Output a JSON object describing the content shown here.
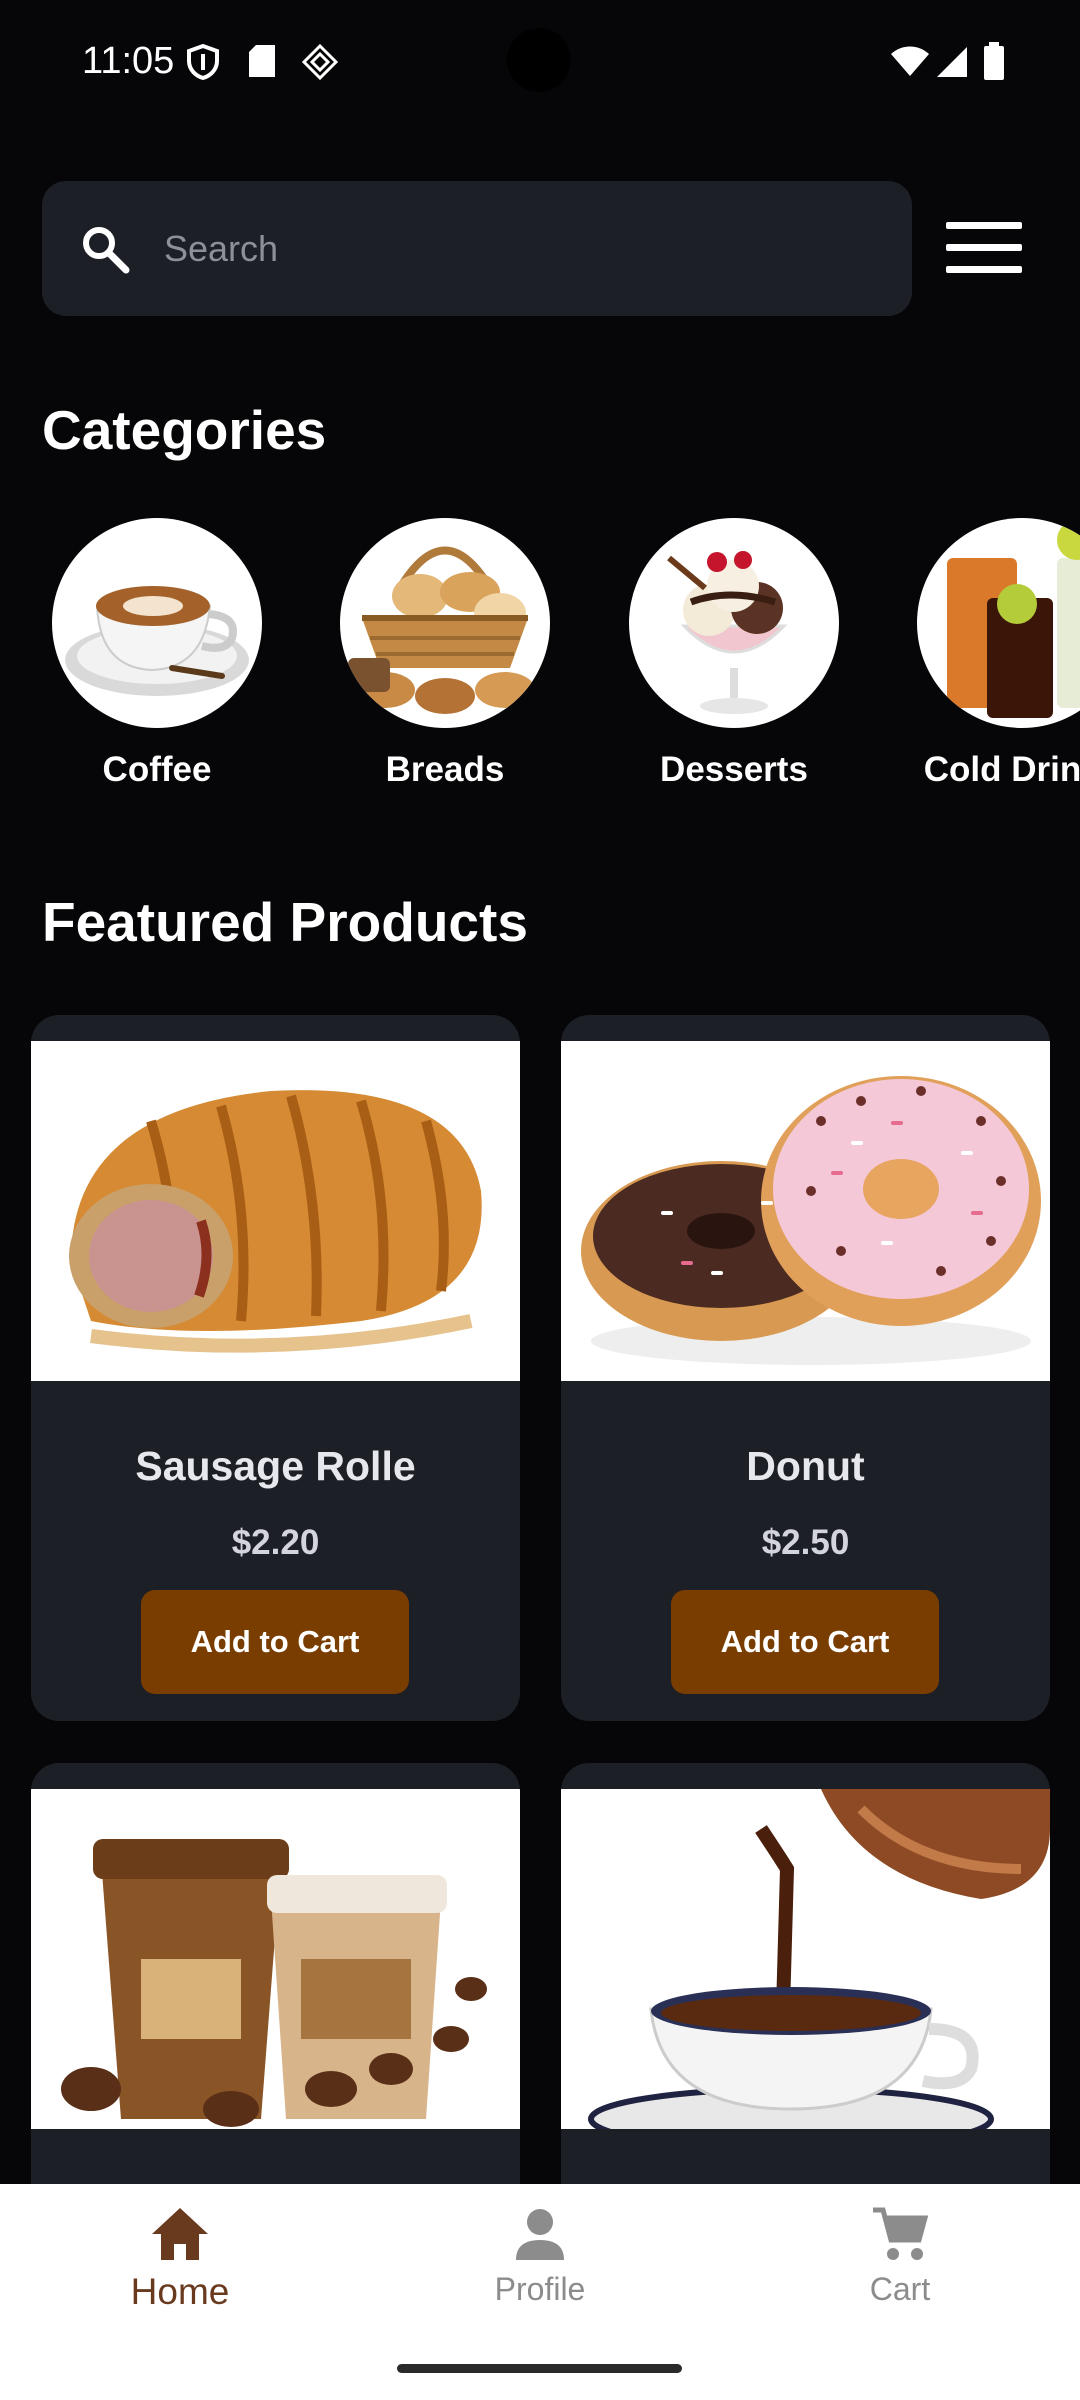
{
  "status_bar": {
    "time": "11:05"
  },
  "search": {
    "placeholder": "Search"
  },
  "sections": {
    "categories_title": "Categories",
    "featured_title": "Featured Products"
  },
  "categories": [
    {
      "name": "Coffee",
      "icon": "coffee-cup-icon"
    },
    {
      "name": "Breads",
      "icon": "bread-basket-icon"
    },
    {
      "name": "Desserts",
      "icon": "ice-cream-icon"
    },
    {
      "name": "Cold Drinks",
      "icon": "cold-drinks-icon"
    }
  ],
  "products": [
    {
      "name": "Sausage Rolle",
      "price": "$2.20",
      "button": "Add to Cart"
    },
    {
      "name": "Donut",
      "price": "$2.50",
      "button": "Add to Cart"
    },
    {
      "name": "",
      "price": "",
      "button": ""
    },
    {
      "name": "",
      "price": "",
      "button": ""
    }
  ],
  "bottom_nav": {
    "items": [
      {
        "label": "Home",
        "icon": "home-icon",
        "active": true
      },
      {
        "label": "Profile",
        "icon": "person-icon",
        "active": false
      },
      {
        "label": "Cart",
        "icon": "cart-icon",
        "active": false
      }
    ]
  },
  "colors": {
    "background": "#060608",
    "card": "#1c1f26",
    "button": "#7a3d00",
    "nav_active": "#6a3a1e"
  }
}
